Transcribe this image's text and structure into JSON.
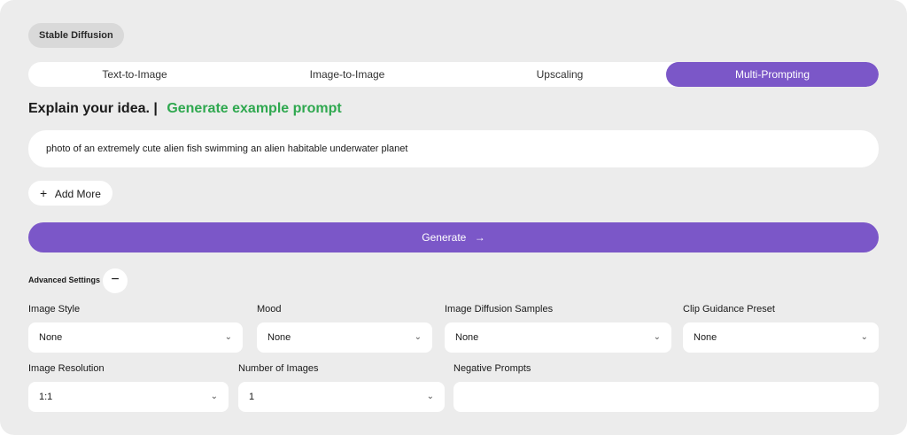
{
  "badge": "Stable Diffusion",
  "tabs": [
    {
      "label": "Text-to-Image"
    },
    {
      "label": "Image-to-Image"
    },
    {
      "label": "Upscaling"
    },
    {
      "label": "Multi-Prompting"
    }
  ],
  "active_tab": "Multi-Prompting",
  "heading": {
    "text": "Explain your idea. |",
    "link": "Generate example prompt"
  },
  "prompt": "photo of an extremely cute alien fish swimming an alien habitable underwater planet",
  "add_more": {
    "icon": "plus-icon",
    "label": "Add More"
  },
  "generate": {
    "label": "Generate",
    "icon": "arrow-right-icon"
  },
  "advanced": {
    "label": "Advanced Settings",
    "toggle": "−"
  },
  "fields": {
    "image_style": {
      "label": "Image Style",
      "value": "None"
    },
    "mood": {
      "label": "Mood",
      "value": "None"
    },
    "diffusion_samples": {
      "label": "Image Diffusion Samples",
      "value": "None"
    },
    "clip_guidance": {
      "label": "Clip Guidance Preset",
      "value": "None"
    },
    "resolution": {
      "label": "Image Resolution",
      "value": "1:1"
    },
    "num_images": {
      "label": "Number of Images",
      "value": "1"
    },
    "negative_prompts": {
      "label": "Negative Prompts",
      "value": ""
    }
  },
  "colors": {
    "accent": "#7b57c8",
    "link": "#2fa84f",
    "panel": "#ececec"
  }
}
